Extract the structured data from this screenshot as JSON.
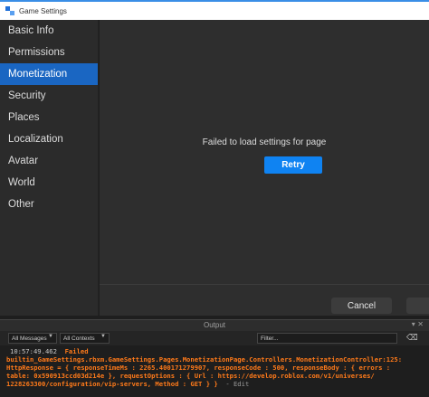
{
  "window": {
    "title": "Game Settings"
  },
  "sidebar": {
    "items": [
      {
        "label": "Basic Info",
        "active": false
      },
      {
        "label": "Permissions",
        "active": false
      },
      {
        "label": "Monetization",
        "active": true
      },
      {
        "label": "Security",
        "active": false
      },
      {
        "label": "Places",
        "active": false
      },
      {
        "label": "Localization",
        "active": false
      },
      {
        "label": "Avatar",
        "active": false
      },
      {
        "label": "World",
        "active": false
      },
      {
        "label": "Other",
        "active": false
      }
    ]
  },
  "main": {
    "error_message": "Failed to load settings for page",
    "retry_label": "Retry",
    "cancel_label": "Cancel"
  },
  "output": {
    "title": "Output",
    "messages_filter": "All Messages",
    "contexts_filter": "All Contexts",
    "filter_placeholder": "Filter...",
    "log": {
      "timestamp": "10:57:49.462",
      "line1": "Failed",
      "line2": "builtin_GameSettings.rbxm.GameSettings.Pages.MonetizationPage.Controllers.MonetizationController:125:",
      "line3": "HttpResponse = { responseTimeMs : 2265.400171279907, responseCode : 500, responseBody : { errors :",
      "line4": "table: 0x590913ccd03d214e }, requestOptions : { Url : https://develop.roblox.com/v1/universes/",
      "line5": "1228263300/configuration/vip-servers, Method : GET } }",
      "edit_label": "- Edit"
    }
  },
  "colors": {
    "accent": "#1a66c2",
    "button": "#0f83f2",
    "error": "#ff7a1a"
  }
}
